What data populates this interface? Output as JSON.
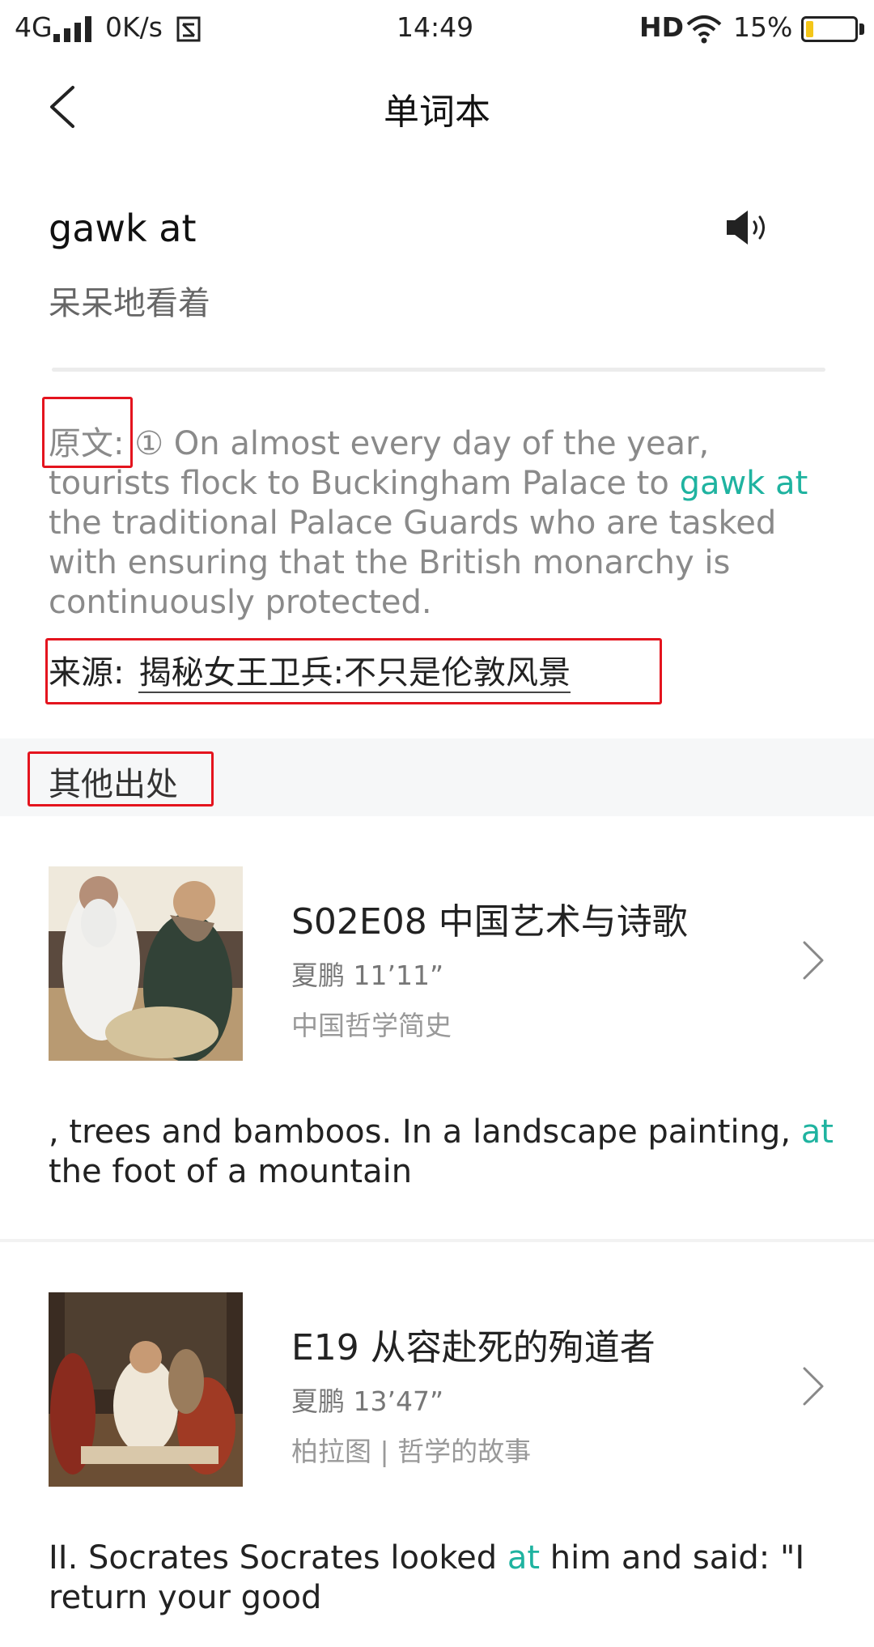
{
  "status_bar": {
    "network": "4G",
    "speed": "0K/s",
    "time": "14:49",
    "hd": "HD",
    "battery_text": "15%",
    "battery_level": 0.15
  },
  "nav": {
    "title": "单词本",
    "back_icon": "chevron-left-icon"
  },
  "word": {
    "term": "gawk at",
    "meaning": "呆呆地看着",
    "audio_icon": "speaker-icon"
  },
  "original": {
    "label": "原文",
    "colon": ":",
    "number": "①",
    "text_before": "On almost every day of the year, tourists flock to Buckingham Palace to",
    "highlight": "gawk at",
    "text_after": "the traditional Palace Guards who are tasked with ensuring that the British monarchy is continuously protected."
  },
  "source": {
    "label": "来源:",
    "link": "揭秘女王卫兵:不只是伦敦风景"
  },
  "other_sources": {
    "header": "其他出处",
    "items": [
      {
        "title": "S02E08 中国艺术与诗歌",
        "meta": "夏鹏 11’11”",
        "series": "中国哲学简史",
        "snippet_before": ", trees and bamboos. In a landscape painting,",
        "snippet_highlight": "at",
        "snippet_after": "the foot of a mountain"
      },
      {
        "title": "E19 从容赴死的殉道者",
        "meta": "夏鹏 13’47”",
        "series": "柏拉图 | 哲学的故事",
        "snippet_before": "II. Socrates Socrates looked",
        "snippet_highlight": "at",
        "snippet_after": "him and said: \"I return your good"
      }
    ]
  },
  "colors": {
    "highlight": "#1fb3a0",
    "annotation_box": "#e4141e"
  }
}
